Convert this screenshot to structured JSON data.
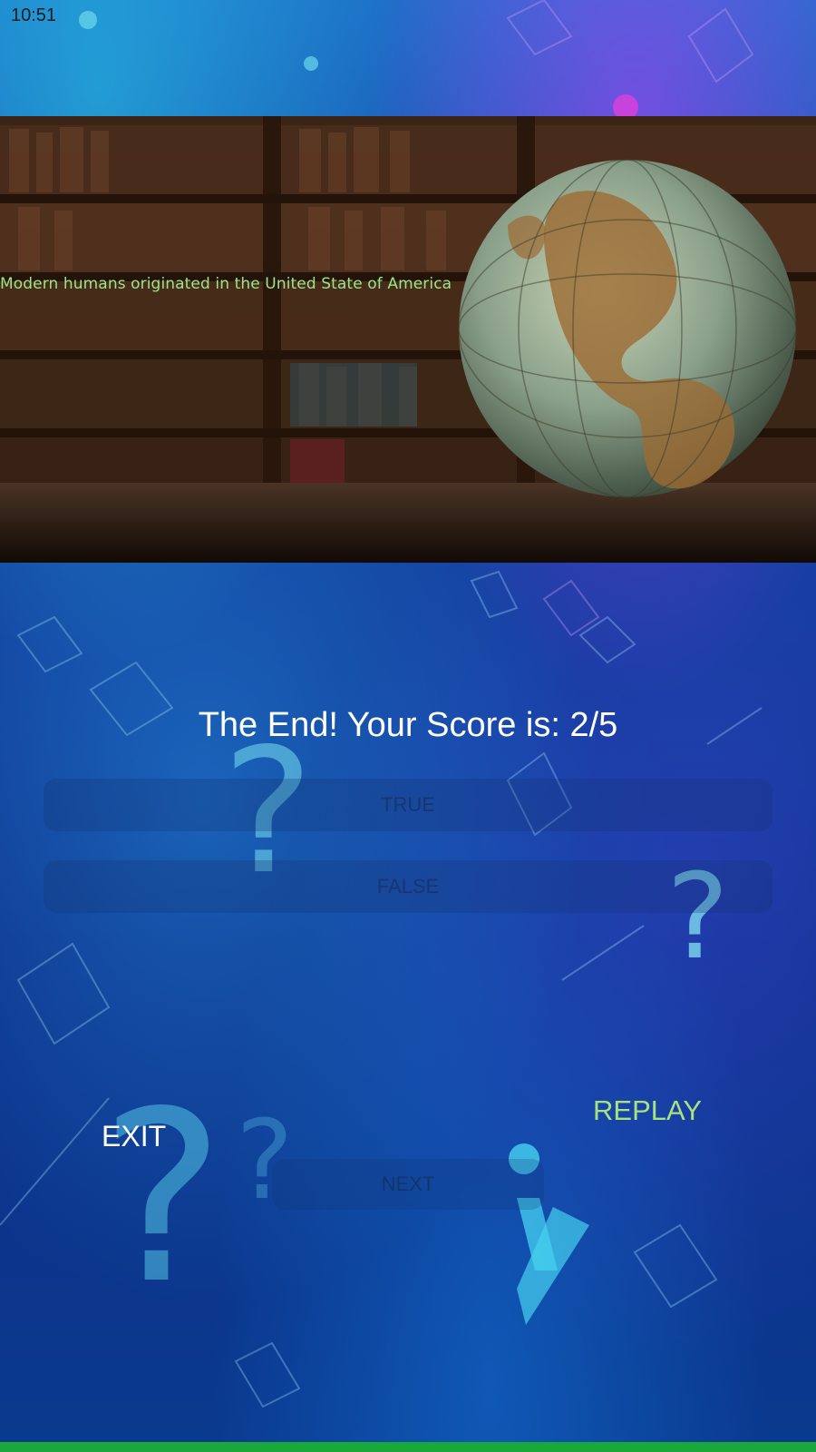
{
  "status_bar": {
    "time": "10:51"
  },
  "question": {
    "text": "Modern humans originated in the United State of America"
  },
  "result": {
    "score_text": "The End! Your Score is: 2/5"
  },
  "answers": {
    "true_label": "TRUE",
    "false_label": "FALSE",
    "next_label": "NEXT"
  },
  "actions": {
    "exit_label": "EXIT",
    "replay_label": "REPLAY"
  },
  "colors": {
    "question_text": "#9be58a",
    "replay_text": "#a6e37d",
    "exit_text": "#ffffff",
    "bottom_bar": "#19a83a"
  },
  "icons": [
    "question-mark-icon",
    "globe-image",
    "bookshelf-image"
  ]
}
